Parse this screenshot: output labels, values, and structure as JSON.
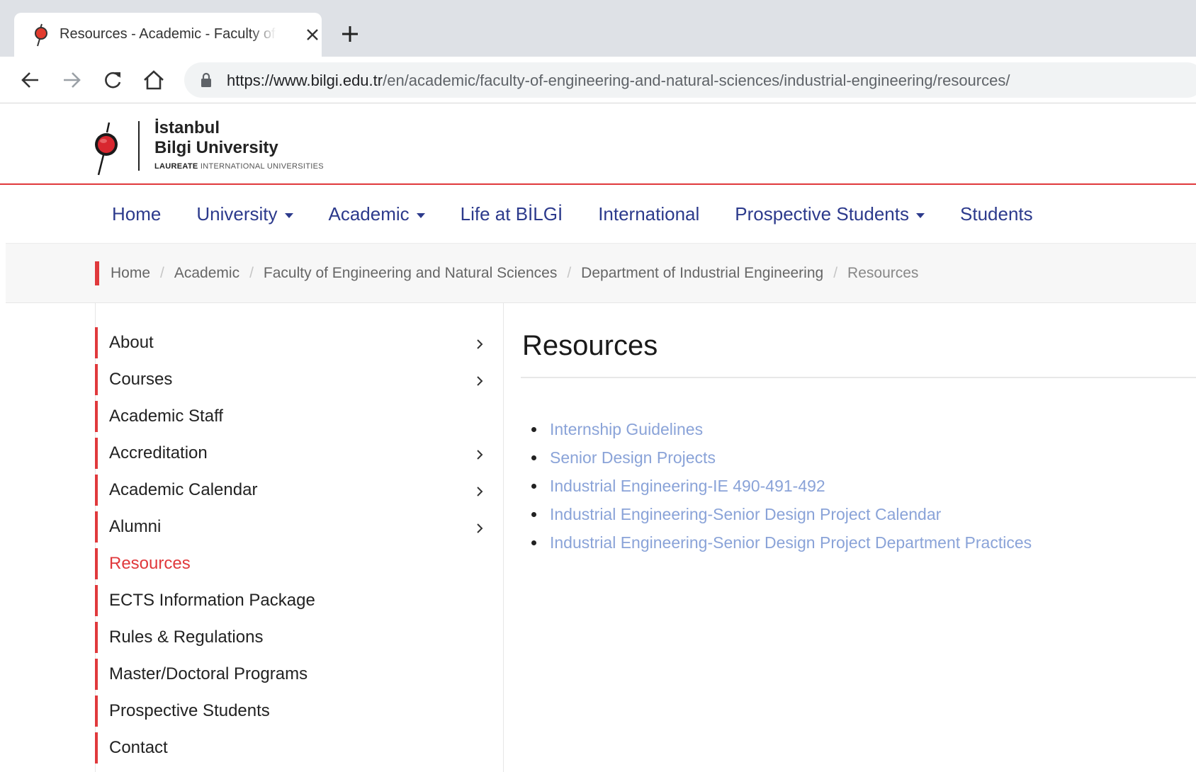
{
  "browser": {
    "tab_title": "Resources - Academic - Faculty of Engineering and Natural Sciences",
    "url_host": "https://www.bilgi.edu.tr",
    "url_path": "/en/academic/faculty-of-engineering-and-natural-sciences/industrial-engineering/resources/"
  },
  "logo": {
    "line1": "İstanbul",
    "line2": "Bilgi University",
    "tag_bold": "LAUREATE",
    "tag_rest": " INTERNATIONAL UNIVERSITIES"
  },
  "main_nav": [
    {
      "label": "Home",
      "dropdown": false
    },
    {
      "label": "University",
      "dropdown": true
    },
    {
      "label": "Academic",
      "dropdown": true
    },
    {
      "label": "Life at BİLGİ",
      "dropdown": false
    },
    {
      "label": "International",
      "dropdown": false
    },
    {
      "label": "Prospective Students",
      "dropdown": true
    },
    {
      "label": "Students",
      "dropdown": false
    }
  ],
  "breadcrumb": [
    "Home",
    "Academic",
    "Faculty of Engineering and Natural Sciences",
    "Department of Industrial Engineering",
    "Resources"
  ],
  "sidebar": [
    {
      "label": "About",
      "chevron": true,
      "active": false
    },
    {
      "label": "Courses",
      "chevron": true,
      "active": false
    },
    {
      "label": "Academic Staff",
      "chevron": false,
      "active": false
    },
    {
      "label": "Accreditation",
      "chevron": true,
      "active": false
    },
    {
      "label": "Academic Calendar",
      "chevron": true,
      "active": false
    },
    {
      "label": "Alumni",
      "chevron": true,
      "active": false
    },
    {
      "label": "Resources",
      "chevron": false,
      "active": true
    },
    {
      "label": "ECTS Information Package",
      "chevron": false,
      "active": false
    },
    {
      "label": "Rules & Regulations",
      "chevron": false,
      "active": false
    },
    {
      "label": "Master/Doctoral Programs",
      "chevron": false,
      "active": false
    },
    {
      "label": "Prospective Students",
      "chevron": false,
      "active": false
    },
    {
      "label": "Contact",
      "chevron": false,
      "active": false
    }
  ],
  "content": {
    "title": "Resources",
    "links": [
      "Internship Guidelines",
      "Senior Design Projects",
      "Industrial Engineering-IE 490-491-492",
      "Industrial Engineering-Senior Design Project Calendar",
      "Industrial Engineering-Senior Design Project Department Practices"
    ]
  },
  "colors": {
    "accent_red": "#e0393c",
    "nav_blue": "#2c3a8c",
    "link_blue": "#8aa3d8"
  }
}
